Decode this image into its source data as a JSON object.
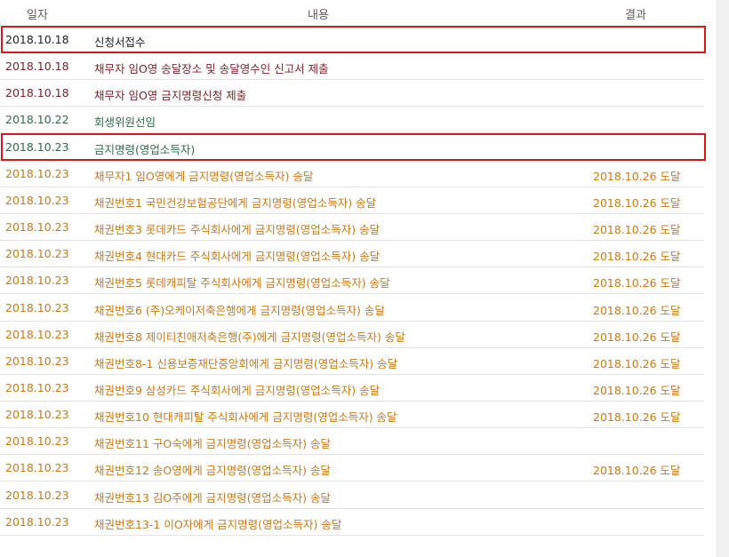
{
  "header": {
    "date": "일자",
    "content": "내용",
    "result": "결과"
  },
  "rows": [
    {
      "date": "2018.10.18",
      "content": "신청서접수",
      "result": "",
      "style": "black",
      "highlight": true
    },
    {
      "date": "2018.10.18",
      "content": "채무자 임O영 송달장소 및 송달영수인 신고서 제출",
      "result": "",
      "style": "maroon",
      "highlight": false
    },
    {
      "date": "2018.10.18",
      "content": "채무자 임O영 금지명령신청 제출",
      "result": "",
      "style": "maroon",
      "highlight": false
    },
    {
      "date": "2018.10.22",
      "content": "회생위원선임",
      "result": "",
      "style": "green",
      "highlight": false
    },
    {
      "date": "2018.10.23",
      "content": "금지명령(영업소득자)",
      "result": "",
      "style": "green",
      "highlight": true
    },
    {
      "date": "2018.10.23",
      "content": "채무자1 임O영에게 금지명령(영업소득자) 송달",
      "result": "2018.10.26 도달",
      "style": "orange",
      "highlight": false
    },
    {
      "date": "2018.10.23",
      "content": "채권번호1 국민건강보험공단에게 금지명령(영업소득자) 송달",
      "result": "2018.10.26 도달",
      "style": "orange",
      "highlight": false
    },
    {
      "date": "2018.10.23",
      "content": "채권번호3 롯데카드 주식회사에게 금지명령(영업소득자) 송달",
      "result": "2018.10.26 도달",
      "style": "orange",
      "highlight": false
    },
    {
      "date": "2018.10.23",
      "content": "채권번호4 현대카드 주식회사에게 금지명령(영업소득자) 송달",
      "result": "2018.10.26 도달",
      "style": "orange",
      "highlight": false
    },
    {
      "date": "2018.10.23",
      "content": "채권번호5 롯데캐피탈 주식회사에게 금지명령(영업소득자) 송달",
      "result": "2018.10.26 도달",
      "style": "orange",
      "highlight": false
    },
    {
      "date": "2018.10.23",
      "content": "채권번호6 (주)오케이저축은행에게 금지명령(영업소득자) 송달",
      "result": "2018.10.26 도달",
      "style": "orange",
      "highlight": false
    },
    {
      "date": "2018.10.23",
      "content": "채권번호8 제이티친애저축은행(주)에게 금지명령(영업소득자) 송달",
      "result": "2018.10.26 도달",
      "style": "orange",
      "highlight": false
    },
    {
      "date": "2018.10.23",
      "content": "채권번호8-1 신용보증재단중앙회에게 금지명령(영업소득자) 송달",
      "result": "2018.10.26 도달",
      "style": "orange",
      "highlight": false
    },
    {
      "date": "2018.10.23",
      "content": "채권번호9 삼성카드 주식회사에게 금지명령(영업소득자) 송달",
      "result": "2018.10.26 도달",
      "style": "orange",
      "highlight": false
    },
    {
      "date": "2018.10.23",
      "content": "채권번호10 현대캐피탈 주식회사에게 금지명령(영업소득자) 송달",
      "result": "2018.10.26 도달",
      "style": "orange",
      "highlight": false
    },
    {
      "date": "2018.10.23",
      "content": "채권번호11 구O숙에게 금지명령(영업소득자) 송달",
      "result": "",
      "style": "orange",
      "highlight": false
    },
    {
      "date": "2018.10.23",
      "content": "채권번호12 송O영에게 금지명령(영업소득자) 송달",
      "result": "2018.10.26 도달",
      "style": "orange",
      "highlight": false
    },
    {
      "date": "2018.10.23",
      "content": "채권번호13 김O주에게 금지명령(영업소득자) 송달",
      "result": "",
      "style": "orange",
      "highlight": false
    },
    {
      "date": "2018.10.23",
      "content": "채권번호13-1 이O자에게 금지명령(영업소득자) 송달",
      "result": "",
      "style": "orange",
      "highlight": false
    }
  ]
}
